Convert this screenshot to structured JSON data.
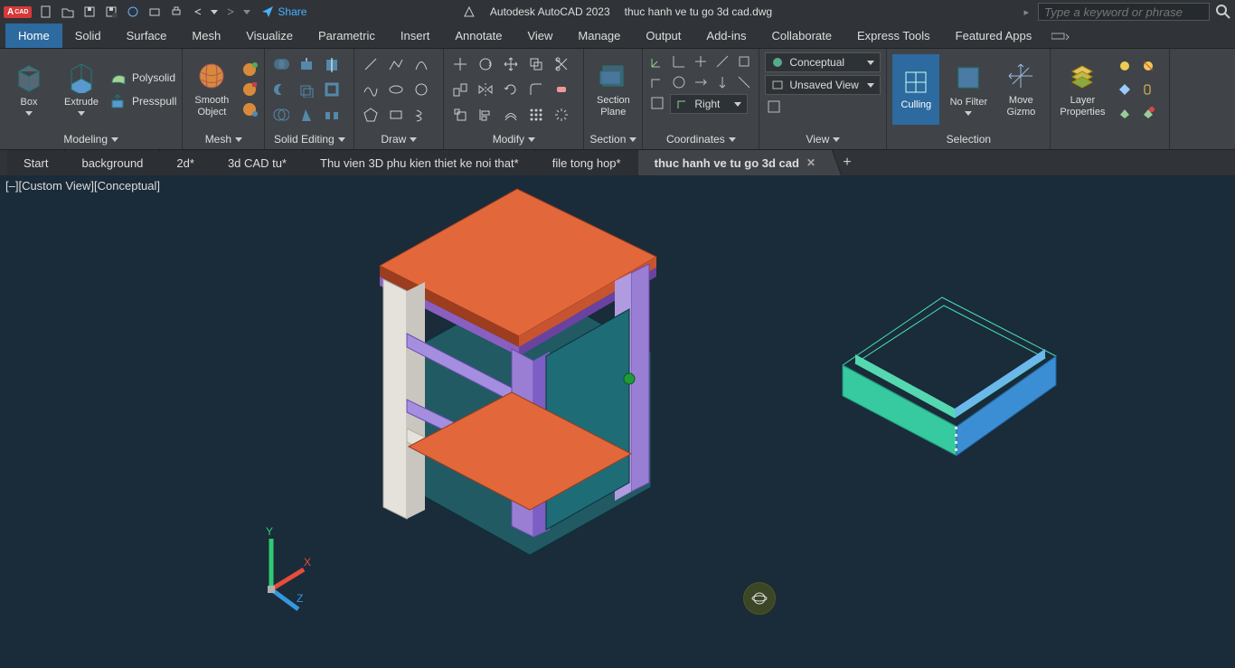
{
  "titlebar": {
    "logo": "A",
    "share": "Share",
    "app": "Autodesk AutoCAD 2023",
    "filename": "thuc hanh ve tu go 3d cad.dwg",
    "search_placeholder": "Type a keyword or phrase"
  },
  "ribbon_tabs": [
    "Home",
    "Solid",
    "Surface",
    "Mesh",
    "Visualize",
    "Parametric",
    "Insert",
    "Annotate",
    "View",
    "Manage",
    "Output",
    "Add-ins",
    "Collaborate",
    "Express Tools",
    "Featured Apps"
  ],
  "ribbon": {
    "box": "Box",
    "extrude": "Extrude",
    "polysolid": "Polysolid",
    "presspull": "Presspull",
    "smooth_object": "Smooth\nObject",
    "section_plane": "Section\nPlane",
    "culling": "Culling",
    "no_filter": "No Filter",
    "move_gizmo": "Move\nGizmo",
    "layer_properties": "Layer\nProperties",
    "visual_style": "Conceptual",
    "unsaved_view": "Unsaved View",
    "ucs_right": "Right",
    "panels": {
      "modeling": "Modeling",
      "mesh": "Mesh",
      "solid_editing": "Solid Editing",
      "draw": "Draw",
      "modify": "Modify",
      "section": "Section",
      "coordinates": "Coordinates",
      "view": "View",
      "selection": "Selection"
    }
  },
  "file_tabs": [
    {
      "label": "Start",
      "active": false
    },
    {
      "label": "background",
      "active": false
    },
    {
      "label": "2d*",
      "active": false
    },
    {
      "label": "3d CAD tu*",
      "active": false
    },
    {
      "label": "Thu vien 3D phu kien thiet ke noi that*",
      "active": false
    },
    {
      "label": "file tong hop*",
      "active": false
    },
    {
      "label": "thuc hanh ve tu go 3d cad",
      "active": true
    }
  ],
  "viewport": {
    "label": "[–][Custom View][Conceptual]"
  }
}
